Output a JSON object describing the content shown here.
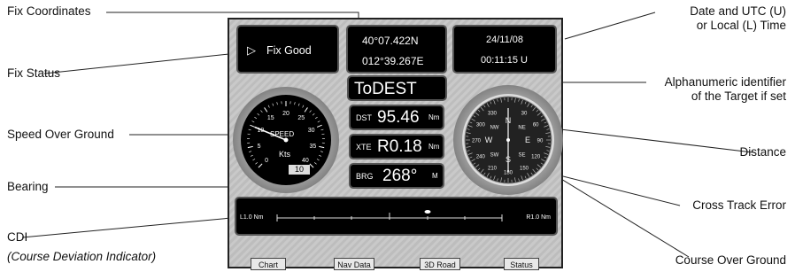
{
  "callouts": {
    "fix_coordinates": "Fix Coordinates",
    "fix_status": "Fix Status",
    "speed_over_ground": "Speed Over Ground",
    "bearing": "Bearing",
    "cdi": "CDI",
    "cdi_sub": "(Course Deviation Indicator)",
    "date_utc_1": "Date and UTC (U)",
    "date_utc_2": "or Local (L) Time",
    "alnum_1": "Alphanumeric identifier",
    "alnum_2": "of the Target if set",
    "distance": "Distance",
    "cross_track_error": "Cross Track Error",
    "course_over_ground": "Course Over Ground"
  },
  "fix": {
    "status": "Fix Good",
    "lat": "40°07.422N",
    "lon": "012°39.267E"
  },
  "datetime": {
    "date": "24/11/08",
    "time": "00:11:15 U"
  },
  "target": {
    "id": "ToDEST"
  },
  "nav": {
    "dst_label": "DST",
    "dst_value": "95.46",
    "dst_unit": "Nm",
    "xte_label": "XTE",
    "xte_value": "R0.18",
    "xte_unit": "Nm",
    "brg_label": "BRG",
    "brg_value": "268°",
    "brg_unit": "M"
  },
  "speed_gauge": {
    "title": "SPEED",
    "unit": "Kts",
    "readout": "10",
    "ticks": [
      "0",
      "5",
      "10",
      "15",
      "20",
      "25",
      "30",
      "35",
      "40"
    ]
  },
  "compass": {
    "labels": [
      "N",
      "NE",
      "E",
      "SE",
      "S",
      "SW",
      "W",
      "NW"
    ],
    "numbers": [
      "30",
      "60",
      "90",
      "120",
      "150",
      "180",
      "210",
      "240",
      "270",
      "300",
      "330"
    ]
  },
  "cdi": {
    "left": "L1.0 Nm",
    "right": "R1.0 Nm"
  },
  "tabs": [
    "Chart",
    "Nav Data",
    "3D Road",
    "Status"
  ],
  "colors": {
    "screen_bg": "#c4c4c4",
    "box_bg": "#000000",
    "text": "#ffffff"
  }
}
